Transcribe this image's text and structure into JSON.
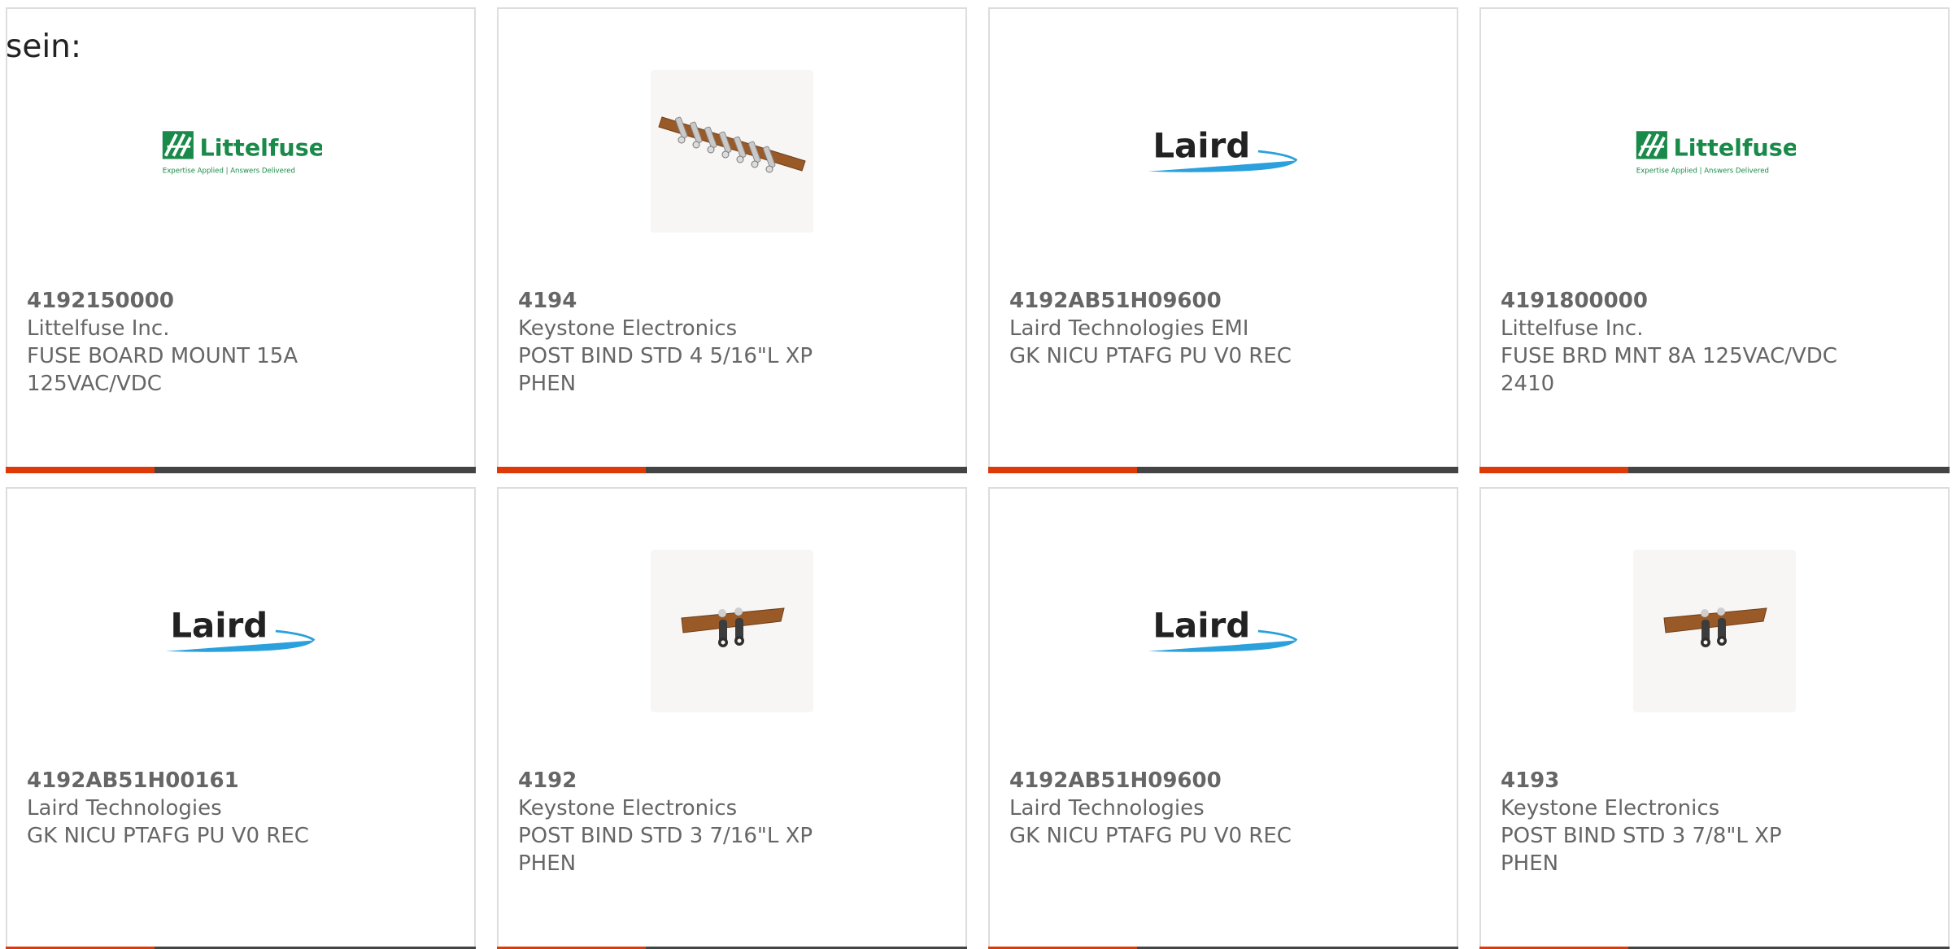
{
  "intro_text": "sein:",
  "colors": {
    "accent_bar": "#dd3a08",
    "bar": "#444444",
    "littelfuse_green": "#1a8a4a",
    "laird_text": "#222222",
    "laird_swoosh": "#2aa0dc",
    "text": "#666666"
  },
  "cards": [
    {
      "part": "4192150000",
      "maker": "Littelfuse Inc.",
      "desc": "FUSE BOARD MOUNT 15A 125VAC/VDC",
      "image": "littelfuse-logo",
      "logo_name": "Littelfuse",
      "logo_tagline": "Expertise Applied | Answers Delivered"
    },
    {
      "part": "4194",
      "maker": "Keystone Electronics",
      "desc": "POST BIND STD 4 5/16\"L XP PHEN",
      "image": "binding-post-strip-photo"
    },
    {
      "part": "4192AB51H09600",
      "maker": "Laird Technologies EMI",
      "desc": "GK NICU PTAFG PU V0 REC",
      "image": "laird-logo",
      "logo_name": "Laird"
    },
    {
      "part": "4191800000",
      "maker": "Littelfuse Inc.",
      "desc": "FUSE BRD MNT 8A 125VAC/VDC 2410",
      "image": "littelfuse-logo",
      "logo_name": "Littelfuse",
      "logo_tagline": "Expertise Applied | Answers Delivered"
    },
    {
      "part": "4192AB51H00161",
      "maker": "Laird Technologies",
      "desc": "GK NICU PTAFG PU V0 REC",
      "image": "laird-logo",
      "logo_name": "Laird"
    },
    {
      "part": "4192",
      "maker": "Keystone Electronics",
      "desc": "POST BIND STD 3 7/16\"L XP PHEN",
      "image": "binding-post-pair-photo"
    },
    {
      "part": "4192AB51H09600",
      "maker": "Laird Technologies",
      "desc": "GK NICU PTAFG PU V0 REC",
      "image": "laird-logo",
      "logo_name": "Laird"
    },
    {
      "part": "4193",
      "maker": "Keystone Electronics",
      "desc": "POST BIND STD 3 7/8\"L XP PHEN",
      "image": "binding-post-pair-photo"
    }
  ]
}
